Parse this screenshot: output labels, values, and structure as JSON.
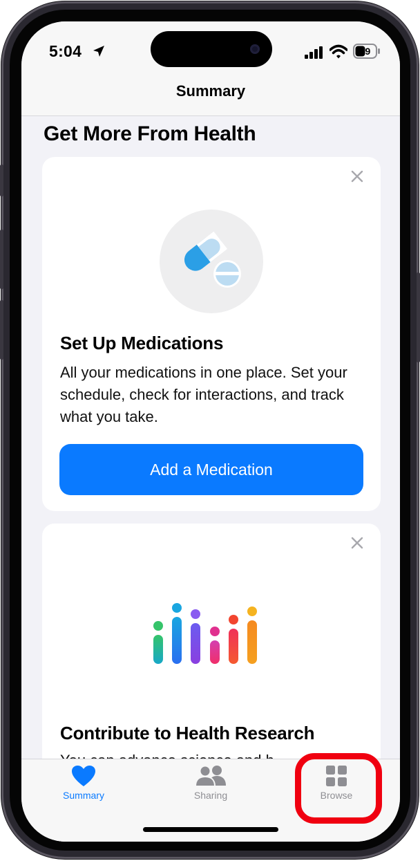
{
  "status_bar": {
    "time": "5:04",
    "battery": "39"
  },
  "nav": {
    "title": "Summary"
  },
  "section_heading": "Get More From Health",
  "cards": [
    {
      "title": "Set Up Medications",
      "description": "All your medications in one place. Set your schedule, check for interactions, and track what you take.",
      "button_label": "Add a Medication",
      "icon": "pills-icon"
    },
    {
      "title": "Contribute to Health Research",
      "description": "You can advance science and h",
      "icon": "health-research-icon"
    }
  ],
  "tab_bar": {
    "tabs": [
      {
        "label": "Summary",
        "icon": "heart-icon",
        "active": true
      },
      {
        "label": "Sharing",
        "icon": "people-icon",
        "active": false
      },
      {
        "label": "Browse",
        "icon": "grid-icon",
        "active": false
      }
    ]
  },
  "colors": {
    "accent": "#0a7aff",
    "highlight": "#f00010",
    "screen_bg": "#f2f2f7"
  }
}
